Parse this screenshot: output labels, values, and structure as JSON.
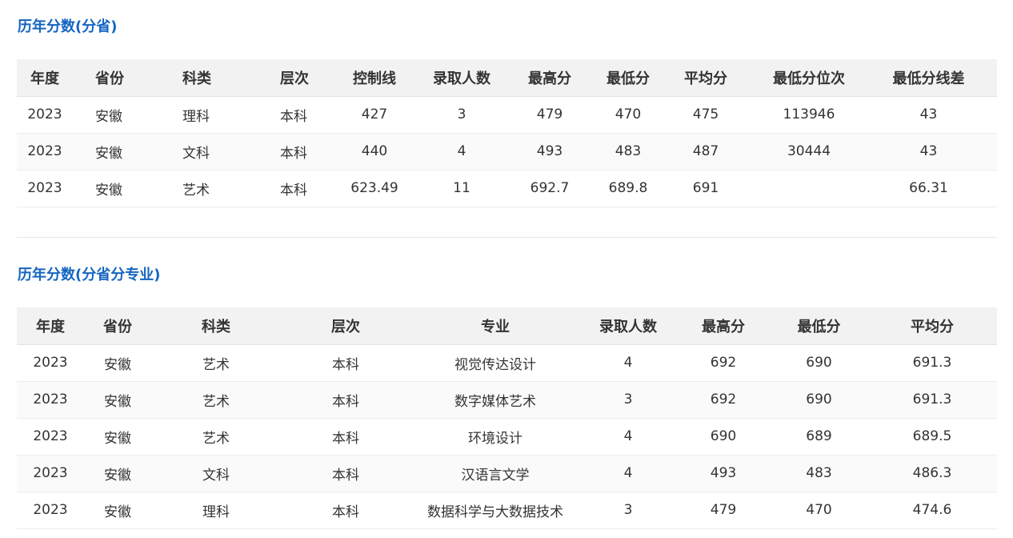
{
  "section1": {
    "title": "历年分数(分省)",
    "headers": [
      "年度",
      "省份",
      "科类",
      "层次",
      "控制线",
      "录取人数",
      "最高分",
      "最低分",
      "平均分",
      "最低分位次",
      "最低分线差"
    ],
    "rows": [
      [
        "2023",
        "安徽",
        "理科",
        "本科",
        "427",
        "3",
        "479",
        "470",
        "475",
        "113946",
        "43"
      ],
      [
        "2023",
        "安徽",
        "文科",
        "本科",
        "440",
        "4",
        "493",
        "483",
        "487",
        "30444",
        "43"
      ],
      [
        "2023",
        "安徽",
        "艺术",
        "本科",
        "623.49",
        "11",
        "692.7",
        "689.8",
        "691",
        "",
        "66.31"
      ]
    ]
  },
  "section2": {
    "title": "历年分数(分省分专业)",
    "headers": [
      "年度",
      "省份",
      "科类",
      "层次",
      "专业",
      "录取人数",
      "最高分",
      "最低分",
      "平均分"
    ],
    "rows": [
      [
        "2023",
        "安徽",
        "艺术",
        "本科",
        "视觉传达设计",
        "4",
        "692",
        "690",
        "691.3"
      ],
      [
        "2023",
        "安徽",
        "艺术",
        "本科",
        "数字媒体艺术",
        "3",
        "692",
        "690",
        "691.3"
      ],
      [
        "2023",
        "安徽",
        "艺术",
        "本科",
        "环境设计",
        "4",
        "690",
        "689",
        "689.5"
      ],
      [
        "2023",
        "安徽",
        "文科",
        "本科",
        "汉语言文学",
        "4",
        "493",
        "483",
        "486.3"
      ],
      [
        "2023",
        "安徽",
        "理科",
        "本科",
        "数据科学与大数据技术",
        "3",
        "479",
        "470",
        "474.6"
      ]
    ]
  },
  "colors": {
    "title": "#1565c0",
    "header_bg": "#f2f2f2",
    "text": "#333333"
  }
}
